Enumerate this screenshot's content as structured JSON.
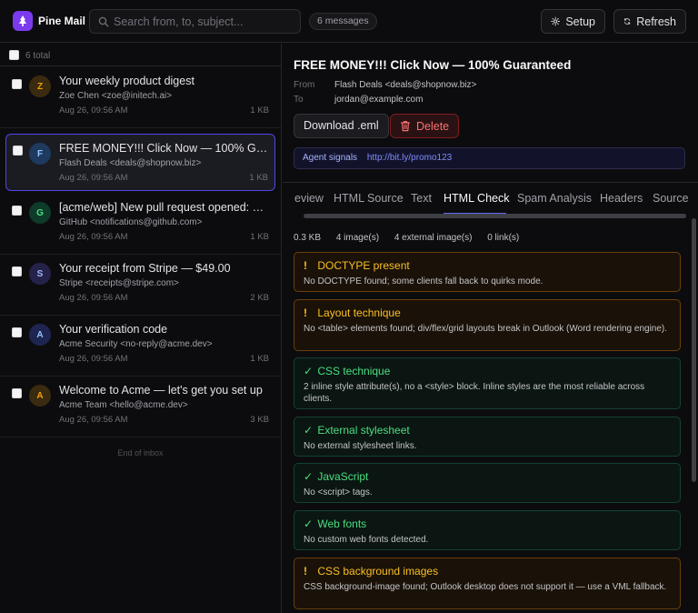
{
  "app": {
    "title": "Pine Mail"
  },
  "search": {
    "placeholder": "Search from, to, subject..."
  },
  "header": {
    "message_count": "6 messages",
    "setup_label": "Setup",
    "refresh_label": "Refresh"
  },
  "list": {
    "total_label": "6 total",
    "end_label": "End of inbox",
    "items": [
      {
        "initial": "Z",
        "subject": "Your weekly product digest",
        "from": "Zoe Chen <zoe@initech.ai>",
        "date": "Aug 26, 09:56 AM",
        "size": "1 KB",
        "avatar_bg": "#3a2a10",
        "avatar_fg": "#f59e0b"
      },
      {
        "initial": "F",
        "subject": "FREE MONEY!!! Click Now — 100% Guaranteed",
        "from": "Flash Deals <deals@shopnow.biz>",
        "date": "Aug 26, 09:56 AM",
        "size": "1 KB",
        "avatar_bg": "#1e3a5f",
        "avatar_fg": "#93c5fd"
      },
      {
        "initial": "G",
        "subject": "[acme/web] New pull request opened: Fix login",
        "from": "GitHub <notifications@github.com>",
        "date": "Aug 26, 09:56 AM",
        "size": "1 KB",
        "avatar_bg": "#0f3b2a",
        "avatar_fg": "#4ade80"
      },
      {
        "initial": "S",
        "subject": "Your receipt from Stripe — $49.00",
        "from": "Stripe <receipts@stripe.com>",
        "date": "Aug 26, 09:56 AM",
        "size": "2 KB",
        "avatar_bg": "#25224a",
        "avatar_fg": "#a5b4fc"
      },
      {
        "initial": "A",
        "subject": "Your verification code",
        "from": "Acme Security <no-reply@acme.dev>",
        "date": "Aug 26, 09:56 AM",
        "size": "1 KB",
        "avatar_bg": "#1e2550",
        "avatar_fg": "#93c5fd"
      },
      {
        "initial": "A",
        "subject": "Welcome to Acme — let's get you set up",
        "from": "Acme Team <hello@acme.dev>",
        "date": "Aug 26, 09:56 AM",
        "size": "3 KB",
        "avatar_bg": "#3a2a10",
        "avatar_fg": "#f59e0b"
      }
    ]
  },
  "message": {
    "subject": "FREE MONEY!!! Click Now — 100% Guaranteed",
    "from_label": "From",
    "from_value": "Flash Deals <deals@shopnow.biz>",
    "to_label": "To",
    "to_value": "jordan@example.com",
    "download_label": "Download .eml",
    "delete_label": "Delete",
    "signals_label": "Agent signals",
    "signals_url": "http://bit.ly/promo123"
  },
  "tabs": [
    "eview",
    "HTML Source",
    "Text",
    "HTML Check",
    "Spam Analysis",
    "Headers",
    "Source"
  ],
  "active_tab": "HTML Check",
  "stats": {
    "size": "0.3 KB",
    "images": "4 image(s)",
    "external_images": "4 external image(s)",
    "links": "0 link(s)"
  },
  "checks": [
    {
      "status": "warn",
      "mark": "!",
      "title": "DOCTYPE present",
      "desc": "No DOCTYPE found; some clients fall back to quirks mode."
    },
    {
      "status": "warn",
      "mark": "!",
      "title": "Layout technique",
      "desc": "No <table> elements found; div/flex/grid layouts break in Outlook (Word rendering engine)."
    },
    {
      "status": "ok",
      "mark": "✓",
      "title": "CSS technique",
      "desc": "2 inline style attribute(s), no a <style> block. Inline styles are the most reliable across clients."
    },
    {
      "status": "ok",
      "mark": "✓",
      "title": "External stylesheet",
      "desc": "No external stylesheet links."
    },
    {
      "status": "ok",
      "mark": "✓",
      "title": "JavaScript",
      "desc": "No <script> tags."
    },
    {
      "status": "ok",
      "mark": "✓",
      "title": "Web fonts",
      "desc": "No custom web fonts detected."
    },
    {
      "status": "warn",
      "mark": "!",
      "title": "CSS background images",
      "desc": "CSS background-image found; Outlook desktop does not support it — use a VML fallback."
    }
  ],
  "colors": {
    "accent": "#6366f1",
    "brand": "#7c3aed",
    "warn": "#fbbf24",
    "ok": "#4ade80",
    "danger": "#f87171"
  }
}
